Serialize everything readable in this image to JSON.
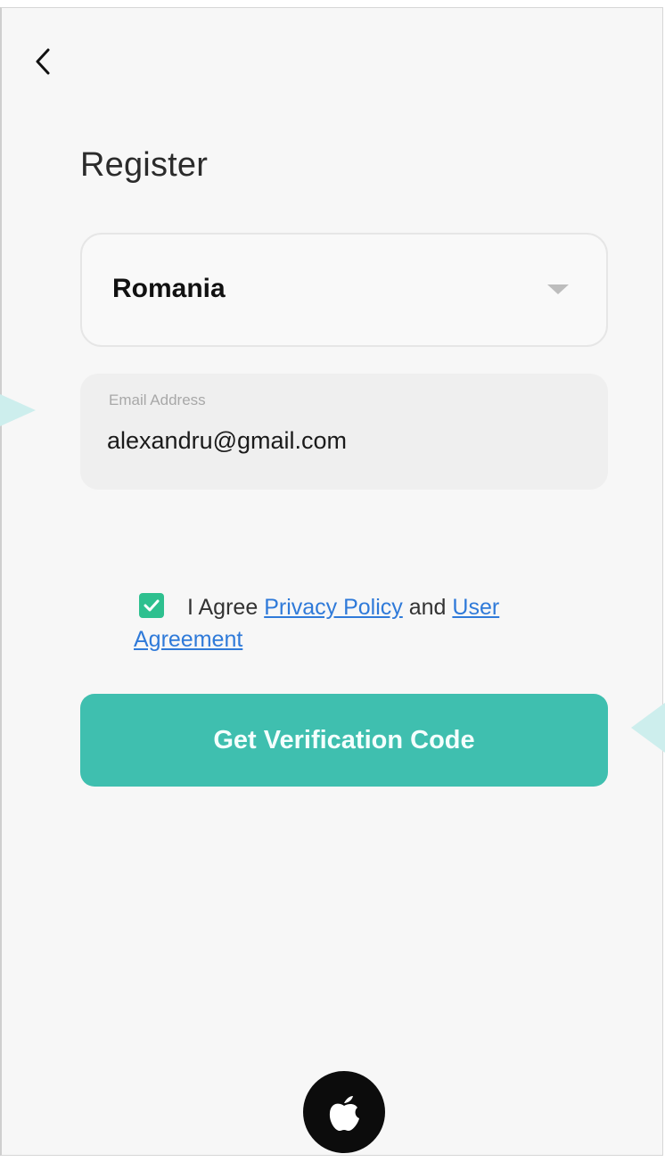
{
  "header": {
    "back_icon": "chevron-left-icon",
    "title": "Register"
  },
  "country": {
    "selected": "Romania",
    "dropdown_icon": "caret-down-icon"
  },
  "email": {
    "label": "Email Address",
    "value": "alexandru@gmail.com"
  },
  "agreement": {
    "checked": true,
    "prefix": "I Agree",
    "privacy_link": "Privacy Policy",
    "conjunction": "and",
    "user_agreement_link": "User Agreement"
  },
  "actions": {
    "primary_label": "Get Verification Code",
    "apple_icon": "apple-icon"
  },
  "colors": {
    "accent": "#3fbfaf",
    "checkbox": "#2ec08f",
    "link": "#2f7ad9",
    "background": "#f7f7f7"
  }
}
